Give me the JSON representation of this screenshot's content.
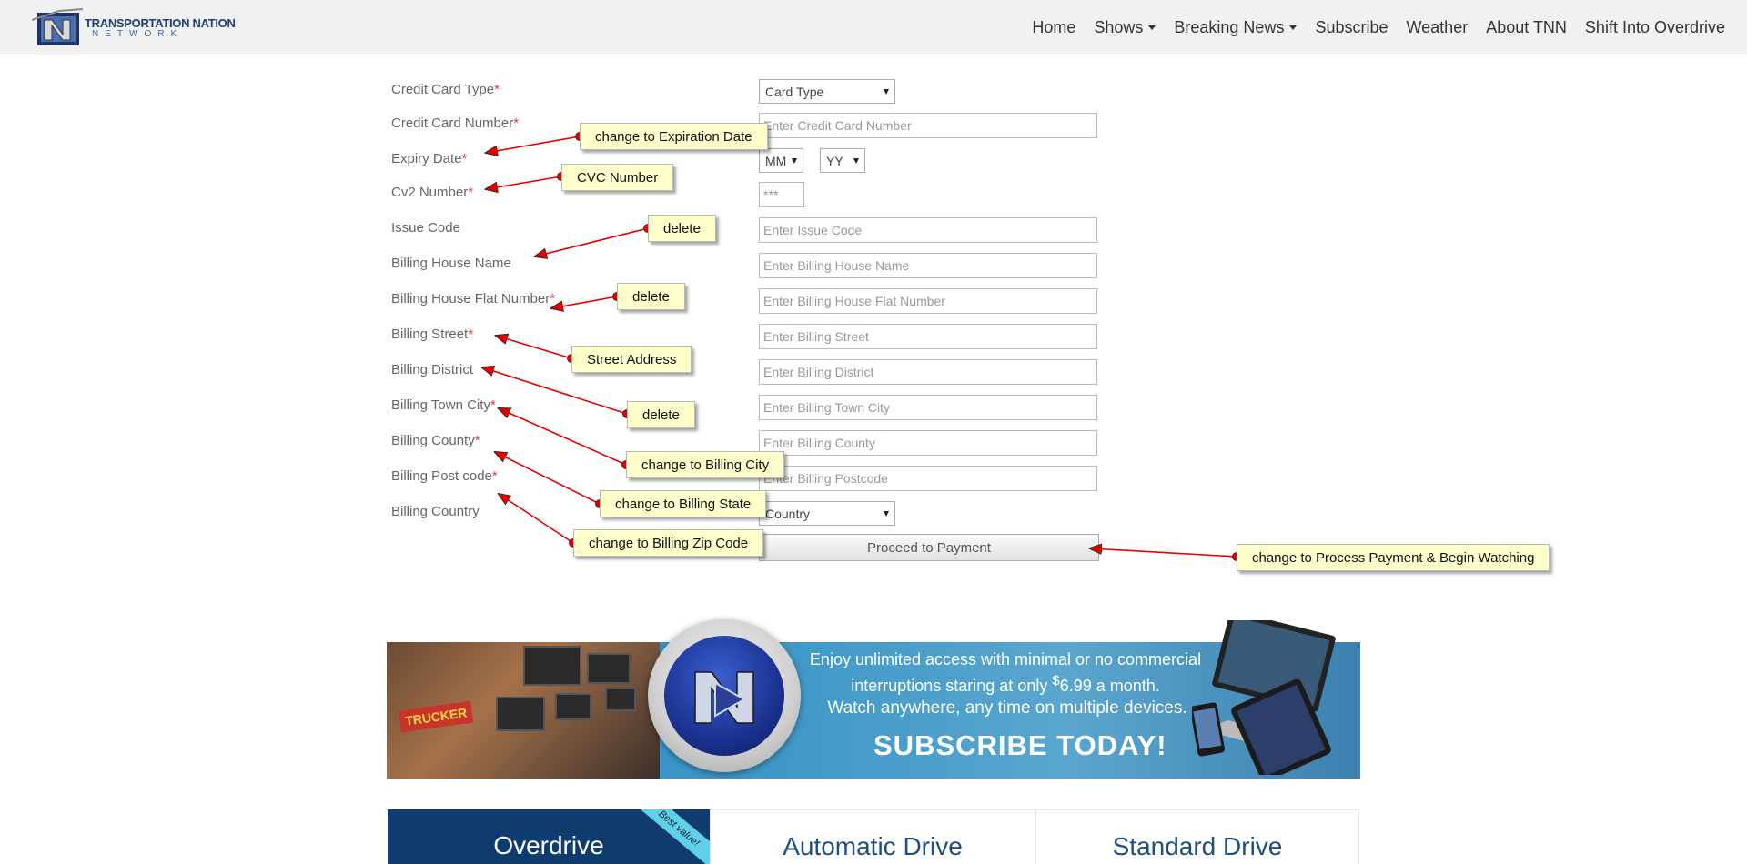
{
  "navbar": {
    "logo_line1": "TRANSPORTATION NATION",
    "logo_line2": "NETWORK",
    "items": [
      {
        "label": "Home",
        "dropdown": false
      },
      {
        "label": "Shows",
        "dropdown": true
      },
      {
        "label": "Breaking News",
        "dropdown": true
      },
      {
        "label": "Subscribe",
        "dropdown": false
      },
      {
        "label": "Weather",
        "dropdown": false
      },
      {
        "label": "About TNN",
        "dropdown": false
      },
      {
        "label": "Shift Into Overdrive",
        "dropdown": false
      }
    ]
  },
  "form": {
    "required_mark": "*",
    "card_type": {
      "label": "Credit Card Type",
      "value": "Card Type"
    },
    "card_number": {
      "label": "Credit Card Number",
      "placeholder": "Enter Credit Card Number"
    },
    "expiry": {
      "label": "Expiry Date",
      "month": "MM",
      "year": "YY"
    },
    "cv2": {
      "label": "Cv2 Number",
      "placeholder": "***"
    },
    "issue_code": {
      "label": "Issue Code",
      "placeholder": "Enter Issue Code"
    },
    "house_name": {
      "label": "Billing House Name",
      "placeholder": "Enter Billing House Name"
    },
    "house_flat": {
      "label": "Billing House Flat Number",
      "placeholder": "Enter Billing House Flat Number"
    },
    "street": {
      "label": "Billing Street",
      "placeholder": "Enter Billing Street"
    },
    "district": {
      "label": "Billing District",
      "placeholder": "Enter Billing District"
    },
    "town_city": {
      "label": "Billing Town City",
      "placeholder": "Enter Billing Town City"
    },
    "county": {
      "label": "Billing County",
      "placeholder": "Enter Billing County"
    },
    "postcode": {
      "label": "Billing Post code",
      "placeholder": "Enter Billing Postcode"
    },
    "country": {
      "label": "Billing Country",
      "value": "Country"
    },
    "submit_label": "Proceed to Payment"
  },
  "annotations": [
    {
      "text": "change to Expiration Date"
    },
    {
      "text": "CVC Number"
    },
    {
      "text": "delete"
    },
    {
      "text": "delete"
    },
    {
      "text": "Street  Address"
    },
    {
      "text": "delete"
    },
    {
      "text": "change to Billing City"
    },
    {
      "text": "change to Billing State"
    },
    {
      "text": "change to Billing Zip Code"
    },
    {
      "text": "change to Process Payment & Begin Watching"
    }
  ],
  "annotation_color": "#e60000",
  "banner": {
    "line1": "Enjoy unlimited access with minimal or no commercial",
    "line2_pre": "interruptions staring at only ",
    "line2_sup": "$",
    "line2_price": "6.99 a month.",
    "line3": "Watch anywhere, any time on multiple devices.",
    "cta": "SUBSCRIBE TODAY!",
    "thumb_text": "TRUCKER"
  },
  "plans": [
    {
      "name": "Overdrive",
      "badge": "Best value!"
    },
    {
      "name": "Automatic Drive"
    },
    {
      "name": "Standard Drive"
    }
  ],
  "colors": {
    "brand": "#0f3b6e",
    "required": "#e23a3a",
    "note_bg": "#ffffcc"
  }
}
